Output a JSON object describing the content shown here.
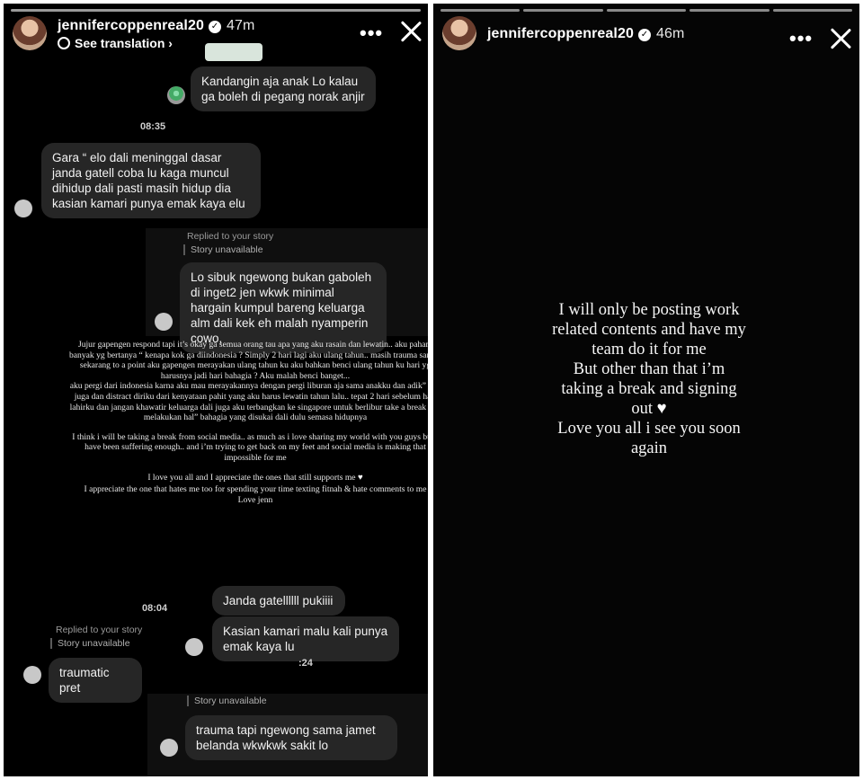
{
  "left_story": {
    "username": "jennifercoppenreal20",
    "time": "47m",
    "see_translation": "See translation",
    "messages": {
      "m1": "Kandangin aja anak Lo kalau ga boleh di pegang norak anjir",
      "ts1": "08:35",
      "m2": "Gara “ elo dali meninggal dasar janda gatell coba lu kaga muncul dihidup dali pasti masih hidup dia kasian kamari punya emak kaya elu",
      "replied1": "Replied to your story",
      "unavailable1": "Story unavailable",
      "m3": "Lo sibuk ngewong bukan gaboleh di inget2 jen wkwk minimal hargain kumpul bareng keluarga alm dali kek eh malah nyamperin cowo,",
      "ts2": "08:04",
      "m4": "Janda gatellllll pukiiii",
      "m5": "Kasian kamari malu kali punya emak kaya lu",
      "ts3": ":24",
      "replied2": "Replied to your story",
      "unavailable2": "Story unavailable",
      "m6": "traumatic pret",
      "unavailable3": "Story unavailable",
      "m7": "trauma tapi ngewong sama jamet belanda wkwkwk sakit lo"
    },
    "story_text": {
      "p1": "Jujur gapengen respond tapi it’s okay ga semua orang tau apa yang aku rasain dan lewatin.. aku paham banyak yg bertanya “ kenapa kok ga diindonesia ? Simply 2 hari lagi aku ulang tahun.. masih trauma sampe sekarang to a point aku gapengen merayakan ulang tahun ku aku bahkan benci ulang tahun ku hari yg harusnya jadi hari bahagia ? Aku malah benci banget...",
      "p2": "aku pergi dari indonesia karna aku mau merayakannya dengan pergi liburan aja sama anakku dan adik” aku juga dan distract diriku dari kenyataan pahit yang aku harus lewatin tahun lalu.. tepat 2 hari sebelum hari lahirku dan jangan khawatir keluarga dali juga aku terbangkan ke singapore untuk berlibur take a break dan melakukan hal” bahagia yang disukai dali dulu semasa hidupnya",
      "p3": "I think i will be taking a break from social media.. as much as i love sharing my world with you guys but i have been suffering enough.. and i’m trying to get back on my feet and social media is making that impossible for me",
      "p4": "I love you all and I appreciate the ones that still supports me",
      "p5": "I appreciate the one that hates me too for spending your time texting fitnah & hate comments to me",
      "p6": "Love jenn"
    }
  },
  "right_story": {
    "username": "jennifercoppenreal20",
    "time": "46m",
    "lines": [
      "I will only be posting work",
      "related contents and have my",
      "team do it for me",
      "But other than that i’m",
      "taking a break and signing",
      "out",
      "Love you all i see you soon",
      "again"
    ]
  },
  "icons": {
    "more": "more-horizontal-icon",
    "close": "close-icon",
    "verified": "verified-badge-icon",
    "translate": "globe-icon",
    "heart": "white-heart-icon"
  }
}
